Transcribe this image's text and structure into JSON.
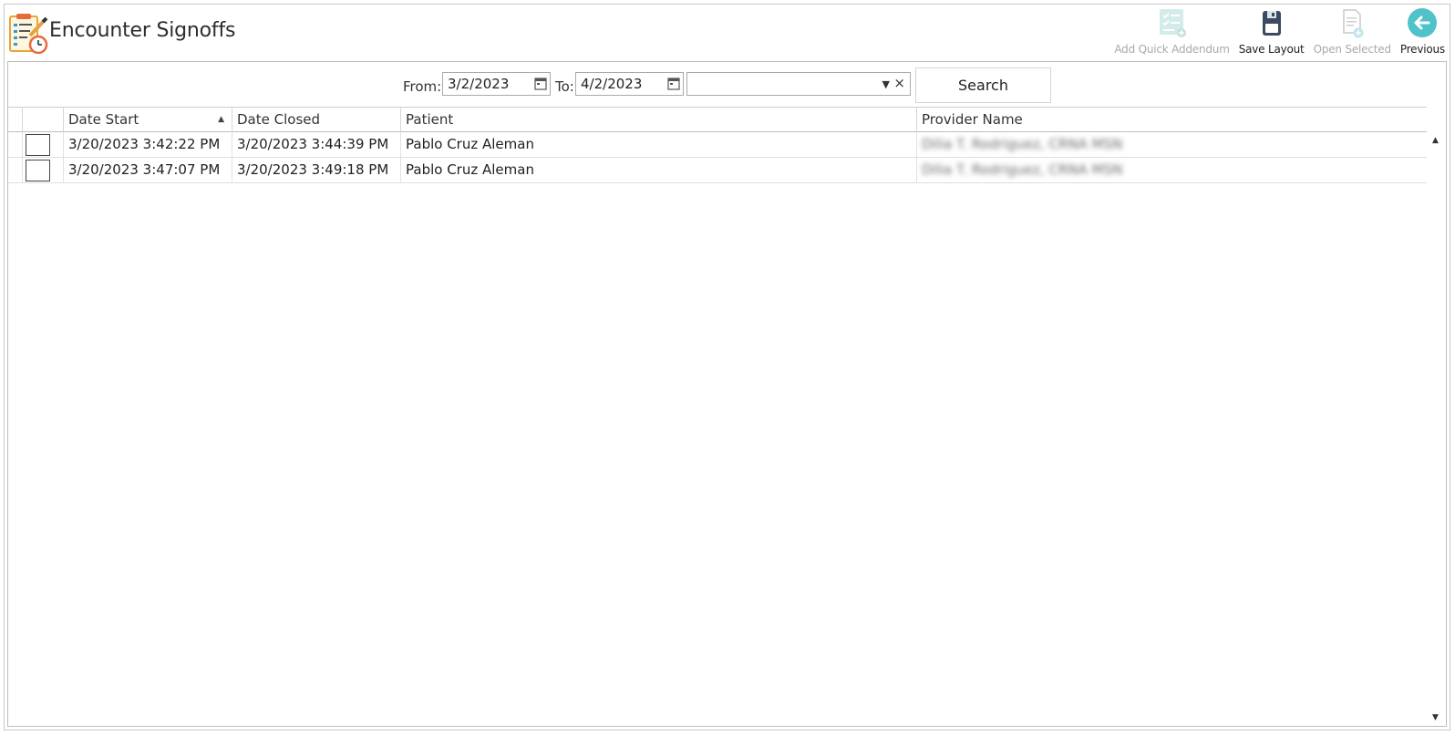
{
  "header": {
    "title": "Encounter Signoffs"
  },
  "toolbar": {
    "add_quick_addendum": "Add Quick Addendum",
    "save_layout": "Save Layout",
    "open_selected": "Open Selected",
    "previous": "Previous"
  },
  "filters": {
    "from_label": "From:",
    "from_value": "3/2/2023",
    "to_label": "To:",
    "to_value": "4/2/2023",
    "combo_value": "",
    "clear_symbol": "×",
    "search_label": "Search"
  },
  "grid": {
    "columns": [
      "",
      "Date Start",
      "Date Closed",
      "Patient",
      "Provider Name"
    ],
    "sort_column": "Date Start",
    "sort_direction": "ascending",
    "rows": [
      {
        "checked": false,
        "date_start": "3/20/2023 3:42:22 PM",
        "date_closed": "3/20/2023 3:44:39 PM",
        "patient": "Pablo Cruz Aleman",
        "provider": "Dilia T. Rodriguez, CRNA MSN"
      },
      {
        "checked": false,
        "date_start": "3/20/2023 3:47:07 PM",
        "date_closed": "3/20/2023 3:49:18 PM",
        "patient": "Pablo Cruz Aleman",
        "provider": "Dilia T. Rodriguez, CRNA MSN"
      }
    ]
  },
  "colors": {
    "accent_teal": "#4fc3c9",
    "disabled_text": "#a9a9a9",
    "save_icon": "#3d4a63"
  },
  "icons": {
    "app": "clipboard-clock-icon",
    "add_addendum": "checklist-plus-icon",
    "save": "floppy-disk-icon",
    "open": "document-plus-icon",
    "previous": "arrow-left-circle-icon"
  }
}
